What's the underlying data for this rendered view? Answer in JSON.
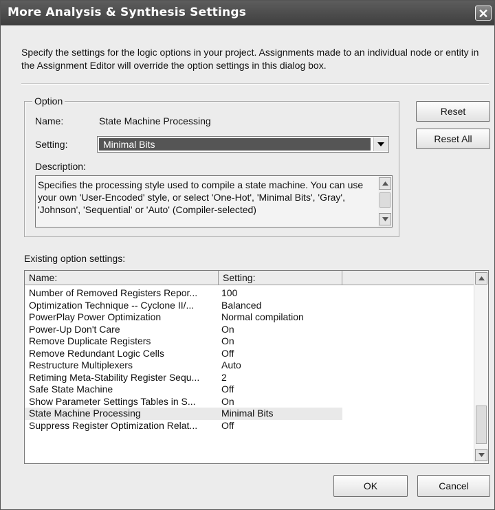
{
  "window": {
    "title": "More Analysis & Synthesis Settings",
    "close_glyph": "✕"
  },
  "intro_text": "Specify the settings for the logic options in your project.  Assignments made to an individual node or entity in the Assignment Editor will override the option settings in this dialog box.",
  "option_group": {
    "legend": "Option",
    "name_label": "Name:",
    "name_value": "State Machine Processing",
    "setting_label": "Setting:",
    "setting_value": "Minimal Bits",
    "description_label": "Description:",
    "description_text": "Specifies the processing style used to compile a state machine. You can use your own 'User-Encoded' style, or select 'One-Hot', 'Minimal Bits', 'Gray', 'Johnson', 'Sequential' or 'Auto' (Compiler-selected)"
  },
  "side_buttons": {
    "reset_label": "Reset",
    "reset_all_label": "Reset All"
  },
  "existing_label": "Existing option settings:",
  "table": {
    "columns": [
      "Name:",
      "Setting:"
    ],
    "rows": [
      {
        "name": "Number of Removed Registers Repor...",
        "setting": "100"
      },
      {
        "name": "Optimization Technique -- Cyclone II/...",
        "setting": "Balanced"
      },
      {
        "name": "PowerPlay Power Optimization",
        "setting": "Normal compilation"
      },
      {
        "name": "Power-Up Don't Care",
        "setting": "On"
      },
      {
        "name": "Remove Duplicate Registers",
        "setting": "On"
      },
      {
        "name": "Remove Redundant Logic Cells",
        "setting": "Off"
      },
      {
        "name": "Restructure Multiplexers",
        "setting": "Auto"
      },
      {
        "name": "Retiming Meta-Stability Register Sequ...",
        "setting": "2"
      },
      {
        "name": "Safe State Machine",
        "setting": "Off"
      },
      {
        "name": "Show Parameter Settings Tables in S...",
        "setting": "On"
      },
      {
        "name": "State Machine Processing",
        "setting": "Minimal Bits"
      },
      {
        "name": "Suppress Register Optimization Relat...",
        "setting": "Off"
      }
    ],
    "selected_row": "State Machine Processing"
  },
  "footer": {
    "ok_label": "OK",
    "cancel_label": "Cancel"
  },
  "icons": {
    "dropdown": "chevron-down-icon",
    "scroll_up": "arrow-up-icon",
    "scroll_down": "arrow-down-icon",
    "close": "close-icon"
  }
}
